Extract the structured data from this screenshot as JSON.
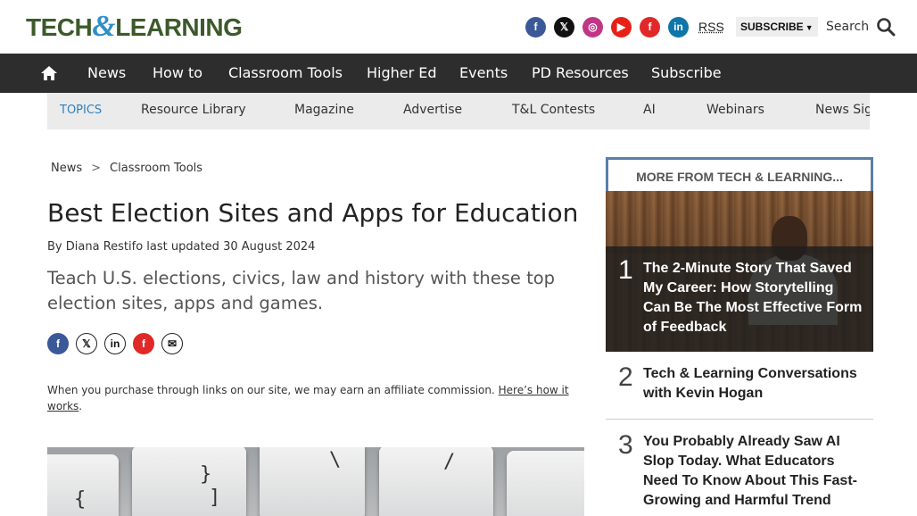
{
  "header": {
    "logo": {
      "part1": "TECH",
      "amp": "&",
      "part2": "LEARNING"
    },
    "social": [
      {
        "icon": "facebook-icon",
        "glyph": "f",
        "color": "#3b5998"
      },
      {
        "icon": "x-icon",
        "glyph": "𝕏",
        "color": "#111111"
      },
      {
        "icon": "instagram-icon",
        "glyph": "◎",
        "color": "#c13584"
      },
      {
        "icon": "youtube-icon",
        "glyph": "▶",
        "color": "#e62117"
      },
      {
        "icon": "flipboard-icon",
        "glyph": "f",
        "color": "#e12828"
      },
      {
        "icon": "linkedin-icon",
        "glyph": "in",
        "color": "#0e76a8"
      }
    ],
    "rss_label": "RSS",
    "subscribe_label": "SUBSCRIBE",
    "search_label": "Search"
  },
  "nav": {
    "items": [
      "News",
      "How to",
      "Classroom Tools",
      "Higher Ed",
      "Events",
      "PD Resources",
      "Subscribe"
    ]
  },
  "topics": {
    "label": "TOPICS",
    "items": [
      "Resource Library",
      "Magazine",
      "Advertise",
      "T&L Contests",
      "AI",
      "Webinars",
      "News Sig"
    ]
  },
  "article": {
    "breadcrumb": [
      "News",
      "Classroom Tools"
    ],
    "breadcrumb_sep": ">",
    "title": "Best Election Sites and Apps for Education",
    "byline_prefix": "By",
    "author": "Diana Restifo",
    "updated": "last updated 30 August 2024",
    "standfirst": "Teach U.S. elections, civics, law and history with these top election sites, apps and games.",
    "share": [
      {
        "icon": "facebook-share-icon",
        "glyph": "f",
        "color": "#3b5998"
      },
      {
        "icon": "x-share-icon",
        "glyph": "𝕏",
        "color": "#111111"
      },
      {
        "icon": "linkedin-share-icon",
        "glyph": "in",
        "color": "#111111"
      },
      {
        "icon": "flipboard-share-icon",
        "glyph": "f",
        "color": "#e12828"
      },
      {
        "icon": "email-share-icon",
        "glyph": "✉",
        "color": "#111111"
      }
    ],
    "disclaimer": "When you purchase through links on our site, we may earn an affiliate commission.",
    "disclaimer_link": "Here’s how it works",
    "disclaimer_end": "."
  },
  "sidebar": {
    "heading": "MORE FROM TECH & LEARNING...",
    "stories": [
      {
        "num": "1",
        "title": "The 2-Minute Story That Saved My Career: How Storytelling Can Be The Most Effective Form of Feedback"
      },
      {
        "num": "2",
        "title": "Tech & Learning Conversations with Kevin Hogan"
      },
      {
        "num": "3",
        "title": "You Probably Already Saw AI Slop Today. What Educators Need To Know About This Fast-Growing and Harmful Trend"
      }
    ]
  }
}
